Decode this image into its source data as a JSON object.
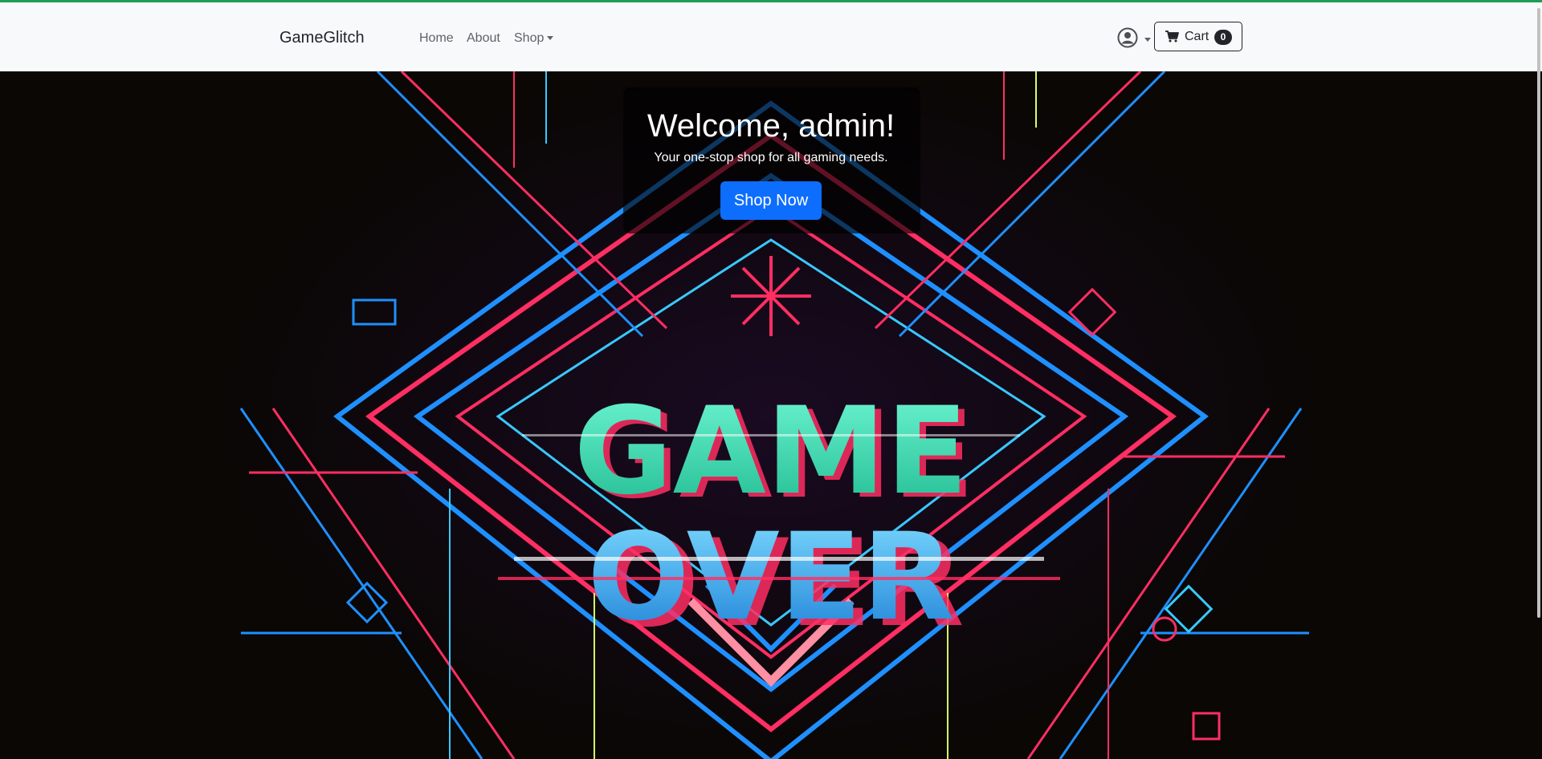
{
  "navbar": {
    "brand": "GameGlitch",
    "links": [
      {
        "label": "Home"
      },
      {
        "label": "About"
      },
      {
        "label": "Shop"
      }
    ],
    "cart": {
      "label": "Cart",
      "count": "0"
    }
  },
  "hero": {
    "title": "Welcome, admin!",
    "subtitle": "Your one-stop shop for all gaming needs.",
    "cta_label": "Shop Now",
    "art_text_line1": "GAME",
    "art_text_line2": "OVER"
  },
  "colors": {
    "accent_top": "#1f9d55",
    "primary_button": "#0d6efd",
    "neon_pink": "#ff2e63",
    "neon_blue": "#1e90ff",
    "neon_green": "#3cffb0"
  }
}
